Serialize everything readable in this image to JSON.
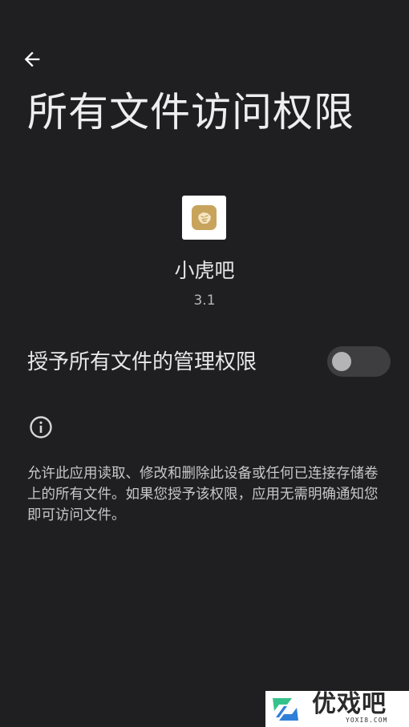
{
  "header": {
    "back_icon": "arrow-back-icon",
    "title": "所有文件访问权限"
  },
  "app": {
    "icon": "app-tiger-icon",
    "name": "小虎吧",
    "version": "3.1"
  },
  "permission": {
    "label": "授予所有文件的管理权限",
    "enabled": false
  },
  "info": {
    "icon": "info-icon",
    "description": "允许此应用读取、修改和删除此设备或任何已连接存储卷上的所有文件。如果您授予该权限，应用无需明确通知您即可访问文件。"
  },
  "watermark": {
    "brand": "优戏吧",
    "domain": "YOXI8.COM"
  },
  "colors": {
    "background": "#1f1f21",
    "toggle_track": "#3e3e41",
    "toggle_knob": "#b4b4b6",
    "app_icon_tile": "#c8a35c",
    "watermark_green": "#35c38b",
    "watermark_blue": "#2f7fd8"
  }
}
